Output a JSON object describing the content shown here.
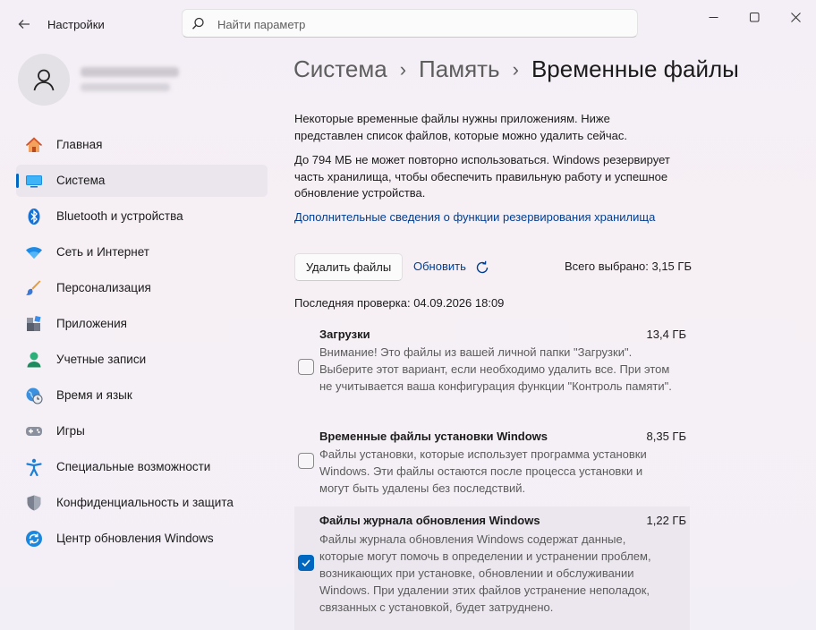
{
  "window": {
    "app_title": "Настройки",
    "search_placeholder": "Найти параметр"
  },
  "sidebar": {
    "items": [
      {
        "label": "Главная",
        "icon": "home-icon"
      },
      {
        "label": "Система",
        "icon": "system-icon"
      },
      {
        "label": "Bluetooth и устройства",
        "icon": "bluetooth-icon"
      },
      {
        "label": "Сеть и Интернет",
        "icon": "wifi-icon"
      },
      {
        "label": "Персонализация",
        "icon": "brush-icon"
      },
      {
        "label": "Приложения",
        "icon": "apps-icon"
      },
      {
        "label": "Учетные записи",
        "icon": "account-icon"
      },
      {
        "label": "Время и язык",
        "icon": "time-language-icon"
      },
      {
        "label": "Игры",
        "icon": "gamepad-icon"
      },
      {
        "label": "Специальные возможности",
        "icon": "accessibility-icon"
      },
      {
        "label": "Конфиденциальность и защита",
        "icon": "shield-icon"
      },
      {
        "label": "Центр обновления Windows",
        "icon": "update-icon"
      }
    ],
    "active_index": 1
  },
  "breadcrumb": {
    "items": [
      "Система",
      "Память",
      "Временные файлы"
    ]
  },
  "main": {
    "intro": "Некоторые временные файлы нужны приложениям. Ниже представлен список файлов, которые можно удалить сейчас.",
    "reserved": "До 794 МБ не может повторно использоваться. Windows резервирует часть хранилища, чтобы обеспечить правильную работу и успешное обновление устройства.",
    "more_info_link": "Дополнительные сведения о функции резервирования хранилища",
    "delete_button": "Удалить файлы",
    "refresh_label": "Обновить",
    "total_selected": "Всего выбрано: 3,15 ГБ",
    "last_check": "Последняя проверка: 04.09.2026 18:09"
  },
  "files": [
    {
      "title": "Загрузки",
      "size": "13,4 ГБ",
      "description": "Внимание! Это файлы из вашей личной папки \"Загрузки\". Выберите этот вариант, если необходимо удалить все. При этом не учитывается ваша конфигурация функции \"Контроль памяти\".",
      "checked": false
    },
    {
      "title": "Временные файлы установки Windows",
      "size": "8,35 ГБ",
      "description": "Файлы установки, которые использует программа установки Windows.  Эти файлы остаются после процесса установки и могут быть удалены без последствий.",
      "checked": false
    },
    {
      "title": "Файлы журнала обновления Windows",
      "size": "1,22 ГБ",
      "description": "Файлы журнала обновления Windows содержат данные, которые могут помочь в определении и устранении проблем, возникающих при установке, обновлении и обслуживании Windows. При удалении этих файлов устранение неполадок, связанных с установкой, будет затруднено.",
      "checked": true
    }
  ],
  "colors": {
    "accent": "#0067c0",
    "link": "#003e92"
  }
}
